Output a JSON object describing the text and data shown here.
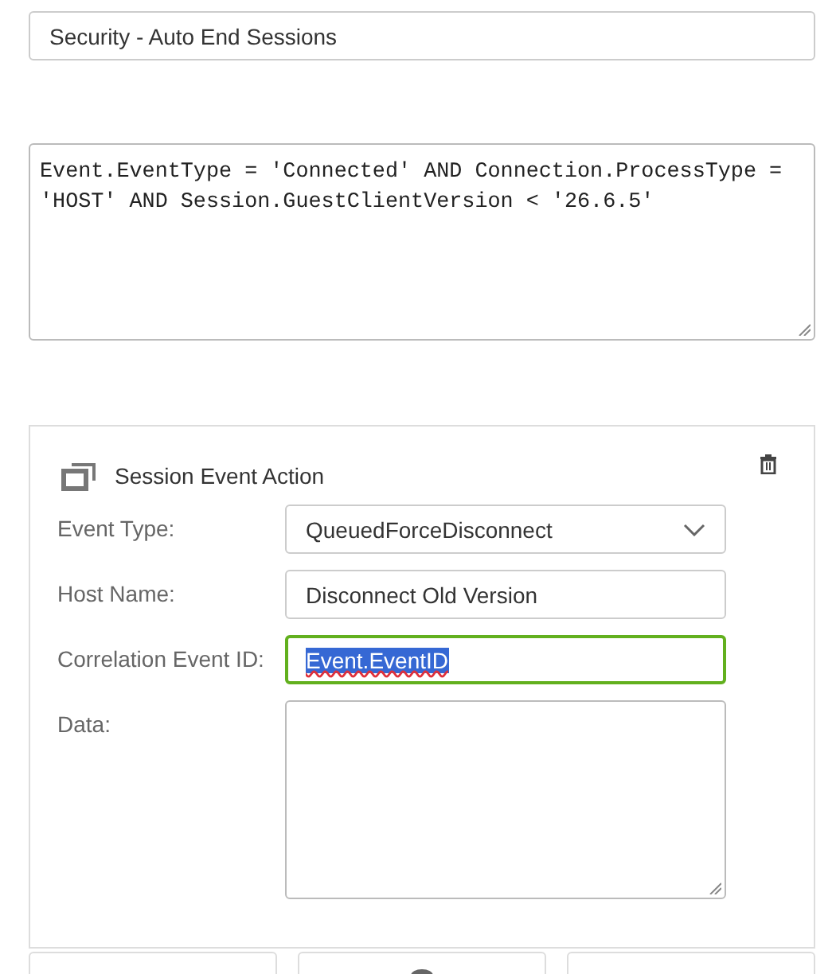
{
  "name_field": {
    "value": "Security - Auto End Sessions"
  },
  "expression": {
    "value": "Event.EventType = 'Connected' AND Connection.ProcessType = 'HOST' AND Session.GuestClientVersion < '26.6.5'"
  },
  "action": {
    "title": "Session Event Action",
    "fields": [
      {
        "kind": "select",
        "label": "Event Type:",
        "value": "QueuedForceDisconnect",
        "focused": false
      },
      {
        "kind": "text",
        "label": "Host Name:",
        "value": "Disconnect Old Version",
        "focused": false,
        "text_selected": false
      },
      {
        "kind": "text",
        "label": "Correlation Event ID:",
        "value": "Event.EventID",
        "focused": true,
        "text_selected": true
      },
      {
        "kind": "textarea",
        "label": "Data:",
        "focused": false
      }
    ]
  },
  "tiles": [
    {
      "kind": "blank"
    },
    {
      "kind": "icon"
    },
    {
      "kind": "blank"
    }
  ]
}
